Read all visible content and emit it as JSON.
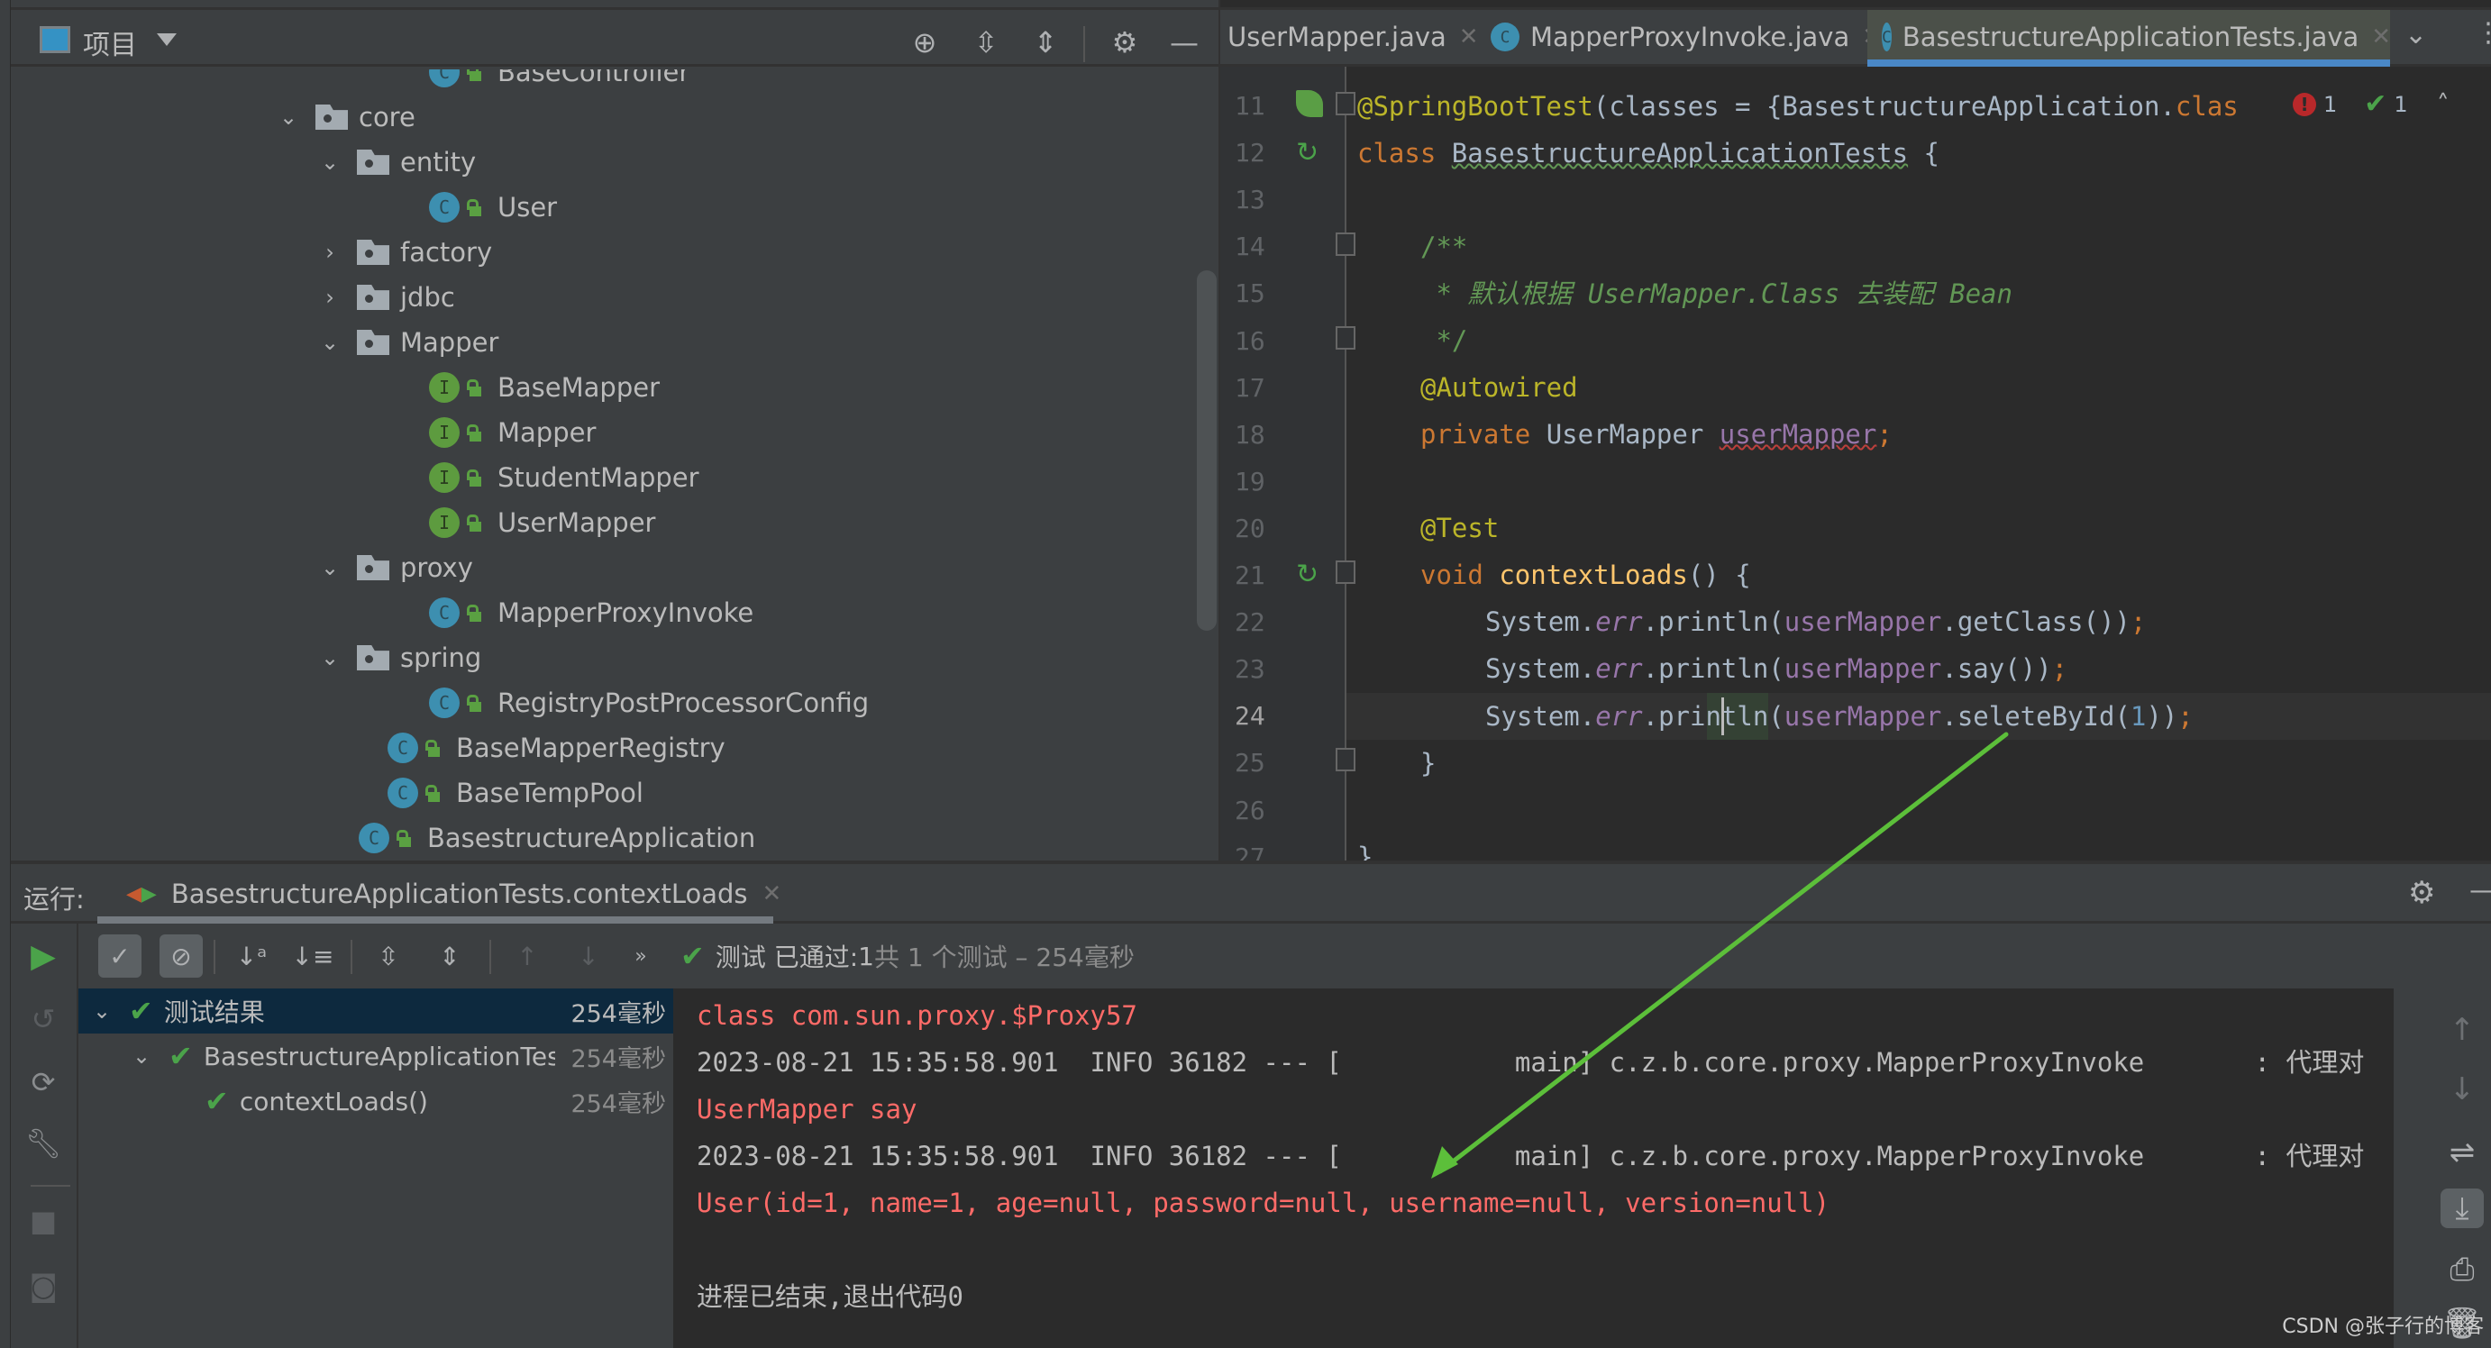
{
  "project_panel": {
    "title": "项目",
    "tree": [
      {
        "label": "BaseController",
        "type": "class",
        "depth": 3,
        "state": "leaf"
      },
      {
        "label": "core",
        "type": "package",
        "depth": 1,
        "state": "expanded"
      },
      {
        "label": "entity",
        "type": "package",
        "depth": 2,
        "state": "expanded"
      },
      {
        "label": "User",
        "type": "class",
        "depth": 3,
        "state": "leaf"
      },
      {
        "label": "factory",
        "type": "package",
        "depth": 2,
        "state": "collapsed"
      },
      {
        "label": "jdbc",
        "type": "package",
        "depth": 2,
        "state": "collapsed"
      },
      {
        "label": "Mapper",
        "type": "package",
        "depth": 2,
        "state": "expanded"
      },
      {
        "label": "BaseMapper",
        "type": "interface",
        "depth": 3,
        "state": "leaf"
      },
      {
        "label": "Mapper",
        "type": "interface",
        "depth": 3,
        "state": "leaf"
      },
      {
        "label": "StudentMapper",
        "type": "interface",
        "depth": 3,
        "state": "leaf"
      },
      {
        "label": "UserMapper",
        "type": "interface",
        "depth": 3,
        "state": "leaf"
      },
      {
        "label": "proxy",
        "type": "package",
        "depth": 2,
        "state": "expanded"
      },
      {
        "label": "MapperProxyInvoke",
        "type": "class",
        "depth": 3,
        "state": "leaf"
      },
      {
        "label": "spring",
        "type": "package",
        "depth": 2,
        "state": "expanded"
      },
      {
        "label": "RegistryPostProcessorConfig",
        "type": "class",
        "depth": 3,
        "state": "leaf"
      },
      {
        "label": "BaseMapperRegistry",
        "type": "class",
        "depth": 2,
        "state": "leaf"
      },
      {
        "label": "BaseTempPool",
        "type": "class",
        "depth": 2,
        "state": "leaf"
      },
      {
        "label": "BasestructureApplication",
        "type": "spring-app",
        "depth": 1,
        "state": "leaf"
      }
    ]
  },
  "editor": {
    "tabs": [
      {
        "label": "UserMapper.java",
        "icon": "interface",
        "active": false
      },
      {
        "label": "MapperProxyInvoke.java",
        "icon": "class",
        "active": false
      },
      {
        "label": "BasestructureApplicationTests.java",
        "icon": "test-class",
        "active": true
      }
    ],
    "inspections": {
      "errors": "1",
      "weak_warnings": "1"
    },
    "current_line": 24,
    "lines": [
      {
        "n": "11",
        "gutter": "spring-leaf"
      },
      {
        "n": "12",
        "gutter": "run-test"
      },
      {
        "n": "13"
      },
      {
        "n": "14"
      },
      {
        "n": "15"
      },
      {
        "n": "16"
      },
      {
        "n": "17"
      },
      {
        "n": "18"
      },
      {
        "n": "19"
      },
      {
        "n": "20"
      },
      {
        "n": "21",
        "gutter": "run-test"
      },
      {
        "n": "22"
      },
      {
        "n": "23"
      },
      {
        "n": "24"
      },
      {
        "n": "25"
      },
      {
        "n": "26"
      },
      {
        "n": "27"
      }
    ],
    "code": {
      "l11_ann": "@SpringBootTest",
      "l11_rest": "(classes = {BasestructureApplication.",
      "l11_kw": "clas",
      "l12_kw": "class ",
      "l12_name": "BasestructureApplicationTests",
      "l12_rest": " {",
      "l14": "/**",
      "l15_a": " * 默认根据 ",
      "l15_b": "UserMapper.Class",
      "l15_c": " 去装配 ",
      "l15_d": "Bean",
      "l16": " */",
      "l17": "@Autowired",
      "l18_kw": "private ",
      "l18_type": "UserMapper ",
      "l18_fld": "userMapper",
      "l18_semi": ";",
      "l20": "@Test",
      "l21_kw": "void ",
      "l21_fn": "contextLoads",
      "l21_rest": "() {",
      "sys": "System.",
      "err": "err",
      "println": ".println(",
      "fld": "userMapper",
      "l22_call": ".getClass())",
      "l23_call": ".say())",
      "l24_dot": ".",
      "l24_method": "seleteById",
      "l24_open": "(",
      "l24_arg": "1",
      "l24_close": "))",
      "semi": ";",
      "l25": "}",
      "l27": "}"
    }
  },
  "run_panel": {
    "label": "运行:",
    "tab": "BasestructureApplicationTests.contextLoads",
    "status_prefix": "测试 已通过: ",
    "status_count": "1",
    "status_suffix": "共 1 个测试 – 254毫秒",
    "test_tree": [
      {
        "label": "测试结果",
        "duration": "254毫秒",
        "depth": 0,
        "selected": true
      },
      {
        "label": "BasestructureApplicationTest",
        "duration": "254毫秒",
        "depth": 1,
        "selected": false
      },
      {
        "label": "contextLoads()",
        "duration": "254毫秒",
        "depth": 2,
        "selected": false
      }
    ],
    "console": [
      {
        "text": "class com.sun.proxy.$Proxy57",
        "kind": "err"
      },
      {
        "text": "2023-08-21 15:35:58.901  INFO 36182 --- [           main] c.z.b.core.proxy.MapperProxyInvoke       : 代理对",
        "kind": "info"
      },
      {
        "text": "UserMapper say",
        "kind": "err"
      },
      {
        "text": "2023-08-21 15:35:58.901  INFO 36182 --- [           main] c.z.b.core.proxy.MapperProxyInvoke       : 代理对",
        "kind": "info"
      },
      {
        "text": "User(id=1, name=1, age=null, password=null, username=null, version=null)",
        "kind": "err"
      },
      {
        "text": "",
        "kind": "info"
      },
      {
        "text": "进程已结束,退出代码0",
        "kind": "info"
      }
    ]
  },
  "annotation": {
    "color": "#5cbf3a",
    "from": "editor line 24 seleteById",
    "to": "console User(...) output"
  },
  "watermark": "CSDN @张子行的博客"
}
